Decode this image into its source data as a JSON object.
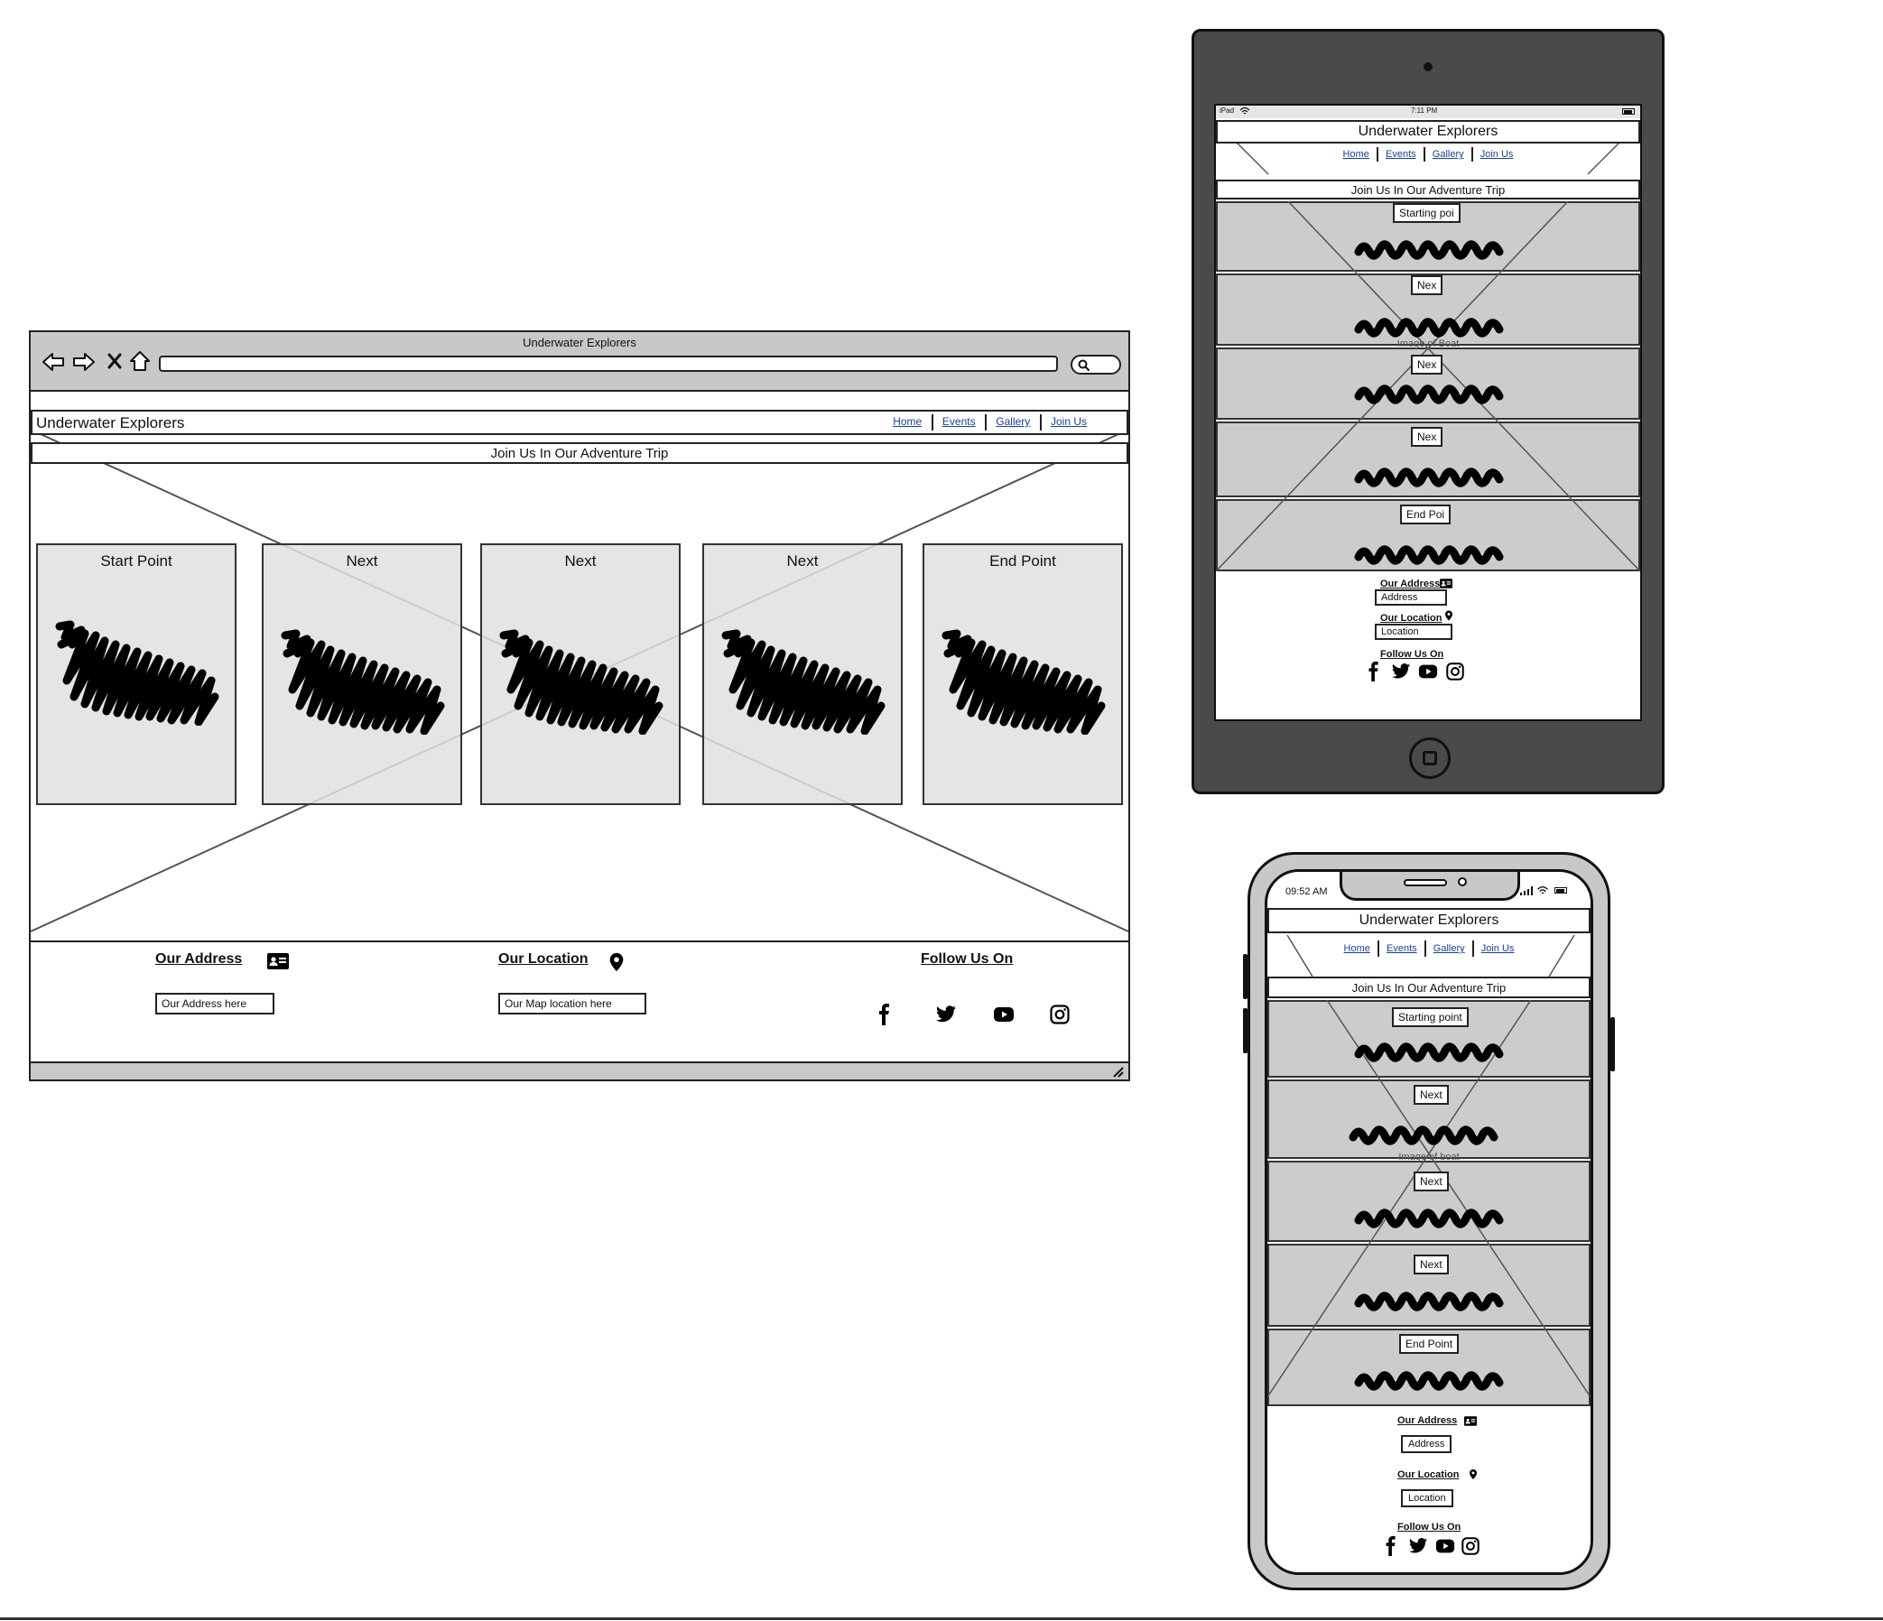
{
  "desktop": {
    "window_title": "Underwater Explorers",
    "site_title": "Underwater Explorers",
    "nav": [
      {
        "label": "Home"
      },
      {
        "label": "Events"
      },
      {
        "label": "Gallery"
      },
      {
        "label": "Join Us"
      }
    ],
    "hero_title": "Join Us In Our Adventure Trip",
    "cards": [
      {
        "label": "Start Point"
      },
      {
        "label": "Next"
      },
      {
        "label": "Next"
      },
      {
        "label": "Next"
      },
      {
        "label": "End Point"
      }
    ],
    "footer": {
      "address_heading": "Our Address",
      "address_value": "Our Address here",
      "location_heading": "Our Location",
      "location_value": "Our Map location here",
      "follow_heading": "Follow Us On"
    }
  },
  "tablet": {
    "status_device": "iPad",
    "status_time": "7:11 PM",
    "site_title": "Underwater Explorers",
    "nav": [
      {
        "label": "Home"
      },
      {
        "label": "Events"
      },
      {
        "label": "Gallery"
      },
      {
        "label": "Join Us"
      }
    ],
    "hero_title": "Join Us In Our Adventure Trip",
    "sections": [
      {
        "label": "Starting poi"
      },
      {
        "label": "Nex"
      },
      {
        "label": "Nex"
      },
      {
        "label": "Nex"
      },
      {
        "label": "End Poi"
      }
    ],
    "image_caption": "Image of Boat",
    "footer": {
      "address_heading": "Our Address",
      "address_value": "Address",
      "location_heading": "Our Location",
      "location_value": "Location",
      "follow_heading": "Follow Us On"
    }
  },
  "phone": {
    "status_time": "09:52 AM",
    "site_title": "Underwater Explorers",
    "nav": [
      {
        "label": "Home"
      },
      {
        "label": "Events"
      },
      {
        "label": "Gallery"
      },
      {
        "label": "Join Us"
      }
    ],
    "hero_title": "Join Us In Our Adventure Trip",
    "sections": [
      {
        "label": "Starting point"
      },
      {
        "label": "Next"
      },
      {
        "label": "Next"
      },
      {
        "label": "Next"
      },
      {
        "label": "End Point"
      }
    ],
    "image_caption": "Image of boat",
    "footer": {
      "address_heading": "Our Address",
      "address_value": "Address",
      "location_heading": "Our Location",
      "location_value": "Location",
      "follow_heading": "Follow Us On"
    }
  },
  "icons": [
    "back-arrow-icon",
    "forward-arrow-icon",
    "close-icon",
    "home-icon",
    "search-icon",
    "contact-card-icon",
    "map-pin-icon",
    "facebook-icon",
    "twitter-icon",
    "youtube-icon",
    "instagram-icon",
    "wifi-icon",
    "battery-icon",
    "signal-icon",
    "home-button-icon",
    "resize-grip-icon"
  ],
  "colors": {
    "browser_chrome": "#c8c8c8",
    "device_body": "#4a4a4a",
    "placeholder": "#e1e1e1",
    "section": "#cccccc",
    "link": "#1b3f9c"
  }
}
